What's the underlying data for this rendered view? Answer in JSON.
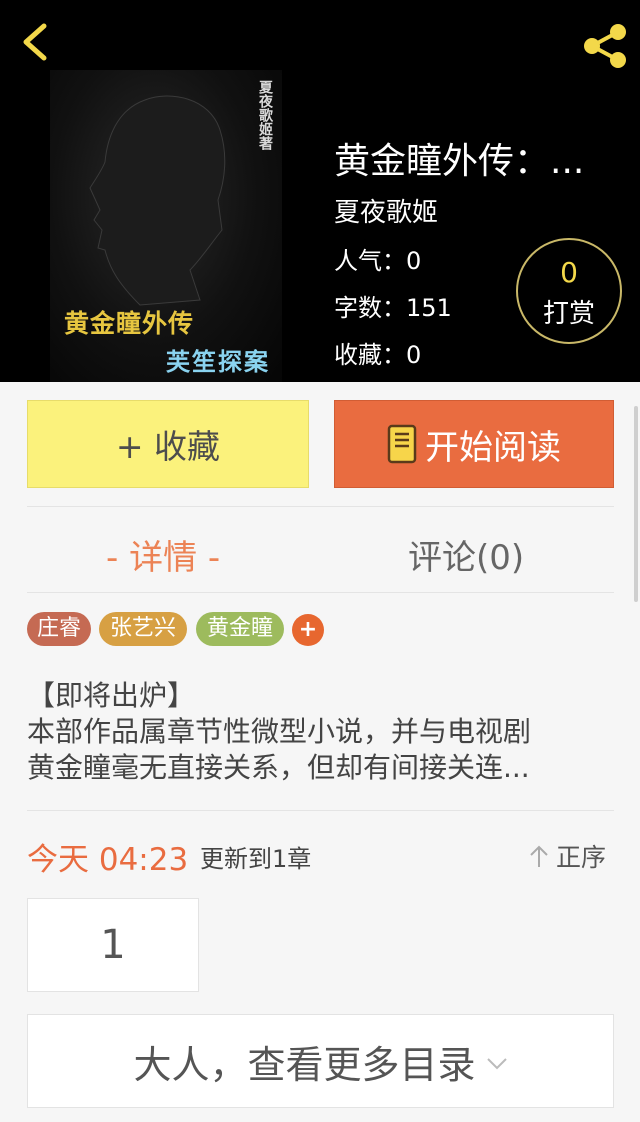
{
  "header": {
    "back_icon": "back-chevron-icon",
    "share_icon": "share-icon",
    "accent_color": "#f3d84a"
  },
  "book": {
    "title": "黄金瞳外传：...",
    "author": "夏夜歌姬",
    "popularity": "人气：0",
    "word_count": "字数：151",
    "favorites": "收藏：0",
    "cover": {
      "vertical_text": "夏夜歌姬著",
      "title_text": "黄金瞳外传",
      "subtitle_text": "芙笙探案"
    }
  },
  "reward": {
    "count": "0",
    "label": "打赏"
  },
  "actions": {
    "collect_label": "+ 收藏",
    "read_label": "开始阅读",
    "collect_color": "#fbf27c",
    "read_color": "#e96c40"
  },
  "tabs": {
    "detail": "- 详情 -",
    "comments": "评论(0)"
  },
  "tags": [
    {
      "label": "庄睿",
      "color": "#c56a53"
    },
    {
      "label": "张艺兴",
      "color": "#d7a043"
    },
    {
      "label": "黄金瞳",
      "color": "#9dbb5d"
    }
  ],
  "tag_add_label": "+",
  "description": {
    "line1": "【即将出炉】",
    "line2": "本部作品属章节性微型小说，并与电视剧",
    "line3": "黄金瞳毫无直接关系，但却有间接关连..."
  },
  "update": {
    "time": "今天 04:23",
    "text": "更新到1章",
    "order_label": "正序"
  },
  "chapters": {
    "first": "1"
  },
  "more_label": "大人，查看更多目录"
}
